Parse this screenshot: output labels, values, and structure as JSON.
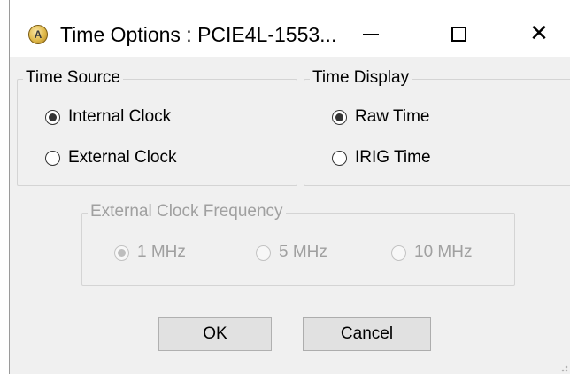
{
  "window": {
    "title": "Time Options : PCIE4L-1553...",
    "app_icon_letter": "A"
  },
  "time_source": {
    "legend": "Time Source",
    "options": [
      {
        "label": "Internal Clock",
        "checked": true
      },
      {
        "label": "External Clock",
        "checked": false
      }
    ]
  },
  "time_display": {
    "legend": "Time Display",
    "options": [
      {
        "label": "Raw Time",
        "checked": true
      },
      {
        "label": "IRIG Time",
        "checked": false
      }
    ]
  },
  "external_clock_frequency": {
    "legend": "External Clock Frequency",
    "enabled": false,
    "options": [
      {
        "label": "1 MHz",
        "checked": true
      },
      {
        "label": "5 MHz",
        "checked": false
      },
      {
        "label": "10 MHz",
        "checked": false
      }
    ]
  },
  "buttons": {
    "ok": "OK",
    "cancel": "Cancel"
  },
  "colors": {
    "dialog_background": "#f0f0f0",
    "titlebar_background": "#ffffff",
    "disabled_text": "#a0a0a0",
    "button_background": "#e1e1e1"
  }
}
